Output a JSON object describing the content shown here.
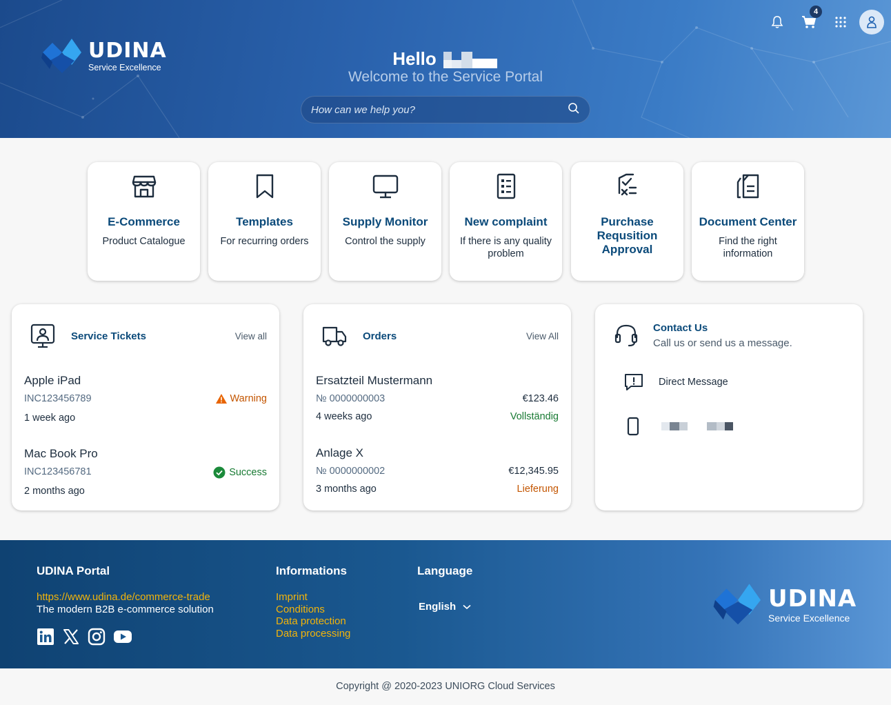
{
  "header": {
    "logo": {
      "word": "UDINA",
      "sub": "Service Excellence"
    },
    "greeting": "Hello",
    "welcome": "Welcome to the Service Portal",
    "search_placeholder": "How can we help you?",
    "cart_count": "4"
  },
  "tiles": [
    {
      "title": "E-Commerce",
      "subtitle": "Product Catalogue",
      "icon": "storefront-icon"
    },
    {
      "title": "Templates",
      "subtitle": "For recurring orders",
      "icon": "bookmark-icon"
    },
    {
      "title": "Supply Monitor",
      "subtitle": "Control the supply",
      "icon": "monitor-icon"
    },
    {
      "title": "New complaint",
      "subtitle": "If there is any quality problem",
      "icon": "document-list-icon"
    },
    {
      "title": "Purchase Requsition Approval",
      "subtitle": "",
      "icon": "approval-checklist-icon"
    },
    {
      "title": "Document Center",
      "subtitle": "Find the right information",
      "icon": "documents-icon"
    }
  ],
  "service_tickets": {
    "title": "Service Tickets",
    "view_all": "View all",
    "items": [
      {
        "name": "Apple iPad",
        "id": "INC123456789",
        "status": "Warning",
        "time": "1 week ago"
      },
      {
        "name": "Mac Book Pro",
        "id": "INC123456781",
        "status": "Success",
        "time": "2 months ago"
      }
    ]
  },
  "orders": {
    "title": "Orders",
    "view_all": "View All",
    "items": [
      {
        "name": "Ersatzteil Mustermann",
        "number": "№ 0000000003",
        "amount": "€123.46",
        "time": "4 weeks ago",
        "status": "Vollständig"
      },
      {
        "name": "Anlage X",
        "number": "№ 0000000002",
        "amount": "€12,345.95",
        "time": "3 months ago",
        "status": "Lieferung"
      }
    ]
  },
  "contact": {
    "title": "Contact Us",
    "subtitle": "Call us or send us a message.",
    "direct_message": "Direct Message"
  },
  "footer": {
    "portal_title": "UDINA Portal",
    "portal_link": "https://www.udina.de/commerce-trade",
    "portal_text": "The modern B2B e-commerce solution",
    "info_title": "Informations",
    "info_links": [
      "Imprint",
      "Conditions",
      "Data protection",
      "Data processing"
    ],
    "language_title": "Language",
    "language_value": "English",
    "logo": {
      "word": "UDINA",
      "sub": "Service Excellence"
    }
  },
  "copyright": "Copyright @ 2020-2023 UNIORG Cloud Services",
  "colors": {
    "primary_text": "#0b4a7a",
    "warning": "#c35500",
    "success": "#187a33",
    "footer_link": "#f3b40a"
  }
}
